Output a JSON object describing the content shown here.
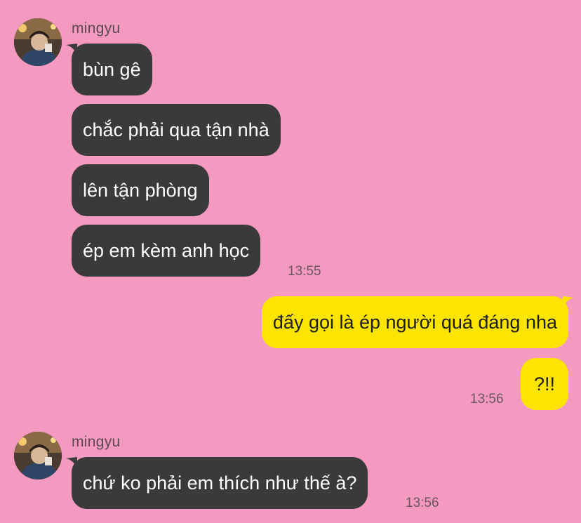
{
  "colors": {
    "background": "#f49ac1",
    "incoming_bubble": "#3b3a3b",
    "outgoing_bubble": "#fee500"
  },
  "conversation": {
    "groups": [
      {
        "sender": "mingyu",
        "avatar_icon": "profile-photo",
        "messages": [
          {
            "text": "bùn gê"
          },
          {
            "text": "chắc phải qua tận nhà"
          },
          {
            "text": "lên tận phòng"
          },
          {
            "text": "ép em kèm anh học"
          }
        ],
        "time": "13:55"
      },
      {
        "sender": "me",
        "messages": [
          {
            "text": "đấy gọi là ép người quá đáng nha"
          },
          {
            "text": "?!!"
          }
        ],
        "time": "13:56"
      },
      {
        "sender": "mingyu",
        "avatar_icon": "profile-photo",
        "messages": [
          {
            "text": "chứ ko phải em thích như thế à?"
          }
        ],
        "time": "13:56"
      }
    ]
  }
}
